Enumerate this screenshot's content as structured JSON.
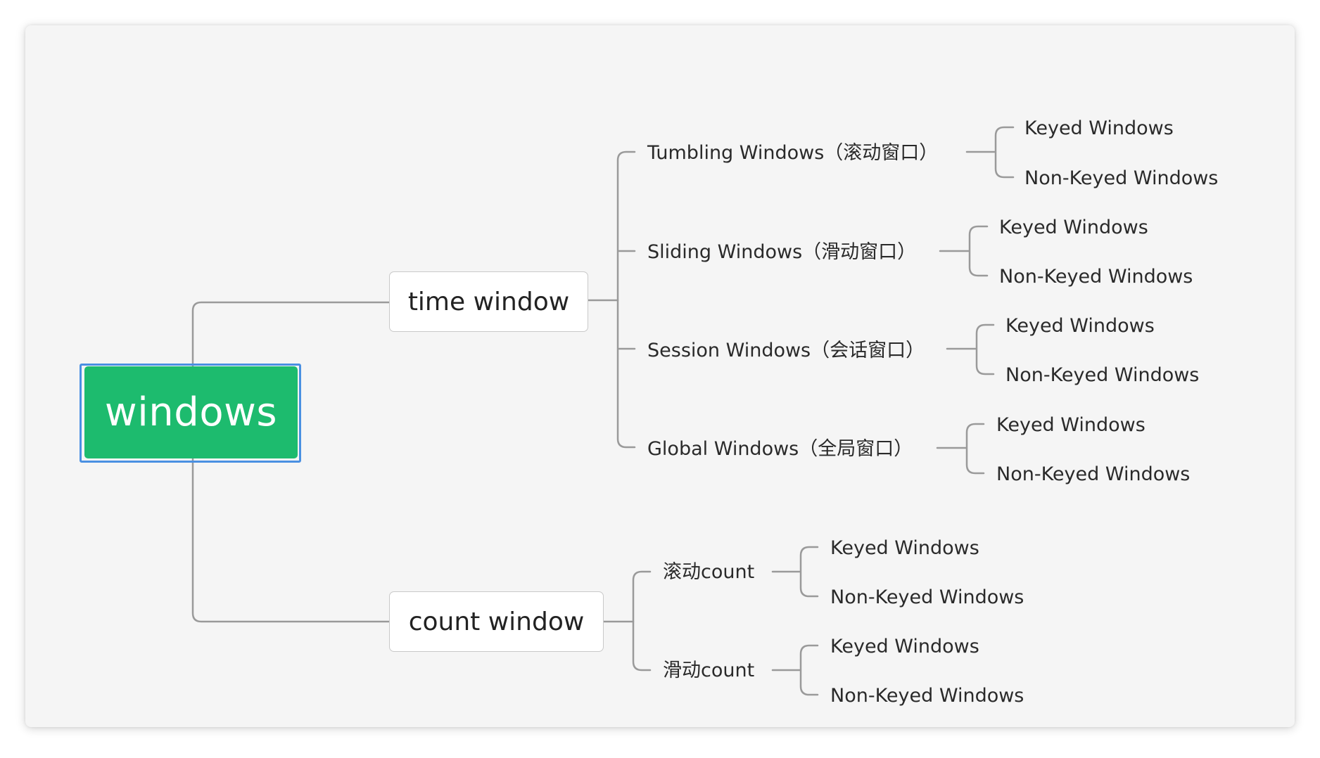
{
  "root": {
    "label": "windows"
  },
  "time_window": {
    "label": "time window",
    "children": [
      {
        "label": "Tumbling Windows（滚动窗口）",
        "leaves": [
          "Keyed Windows",
          "Non-Keyed Windows"
        ]
      },
      {
        "label": "Sliding Windows（滑动窗口）",
        "leaves": [
          "Keyed Windows",
          "Non-Keyed Windows"
        ]
      },
      {
        "label": "Session Windows（会话窗口）",
        "leaves": [
          "Keyed Windows",
          "Non-Keyed Windows"
        ]
      },
      {
        "label": "Global Windows（全局窗口）",
        "leaves": [
          "Keyed Windows",
          "Non-Keyed Windows"
        ]
      }
    ]
  },
  "count_window": {
    "label": "count window",
    "children": [
      {
        "label": "滚动count",
        "leaves": [
          "Keyed Windows",
          "Non-Keyed Windows"
        ]
      },
      {
        "label": "滑动count",
        "leaves": [
          "Keyed Windows",
          "Non-Keyed Windows"
        ]
      }
    ]
  },
  "colors": {
    "root_fill": "#1dbb6e",
    "root_outline": "#4a90e2",
    "connector": "#9a9a9a",
    "background": "#f5f5f5"
  }
}
